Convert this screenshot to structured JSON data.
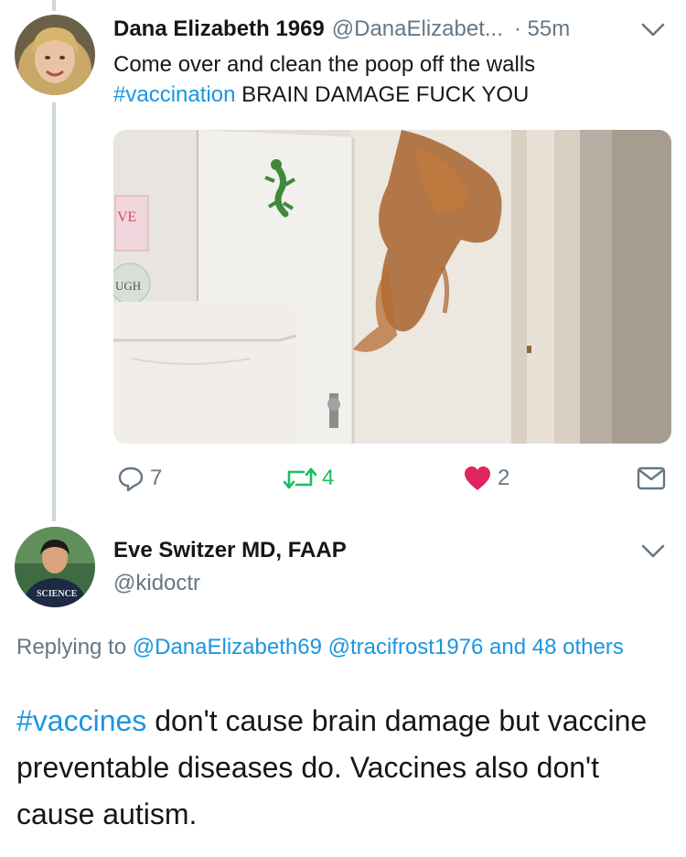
{
  "tweet1": {
    "display_name": "Dana Elizabeth 1969",
    "handle": "@DanaElizabet...",
    "time": "· 55m",
    "text": "Come over and clean the poop off the walls",
    "hashtag": "#vaccination",
    "text_after_hashtag": " BRAIN DAMAGE FUCK YOU",
    "media_sign_top": "VE",
    "media_sign_bottom": "UGH",
    "reply_count": "7",
    "retweet_count": "4",
    "like_count": "2",
    "icons": {
      "reply": "reply-icon",
      "retweet": "retweet-icon",
      "like": "heart-icon",
      "dm": "envelope-icon",
      "menu": "chevron-down-icon"
    }
  },
  "tweet2": {
    "display_name": "Eve Switzer MD, FAAP",
    "handle": "@kidoctr",
    "shirt_text": "SCIENCE",
    "replying_prefix": "Replying to",
    "mention1": "@DanaElizabeth69",
    "mention2": "@tracifrost1976",
    "others": "and 48 others",
    "hashtag": "#vaccines",
    "text": " don't cause brain damage but vaccine preventable diseases do. Vaccines also don't cause autism."
  },
  "colors": {
    "link": "#1b95e0",
    "secondary_text": "#657786",
    "retweet": "#17bf63",
    "like": "#e0245e",
    "thread_line": "#ccd6dd"
  }
}
